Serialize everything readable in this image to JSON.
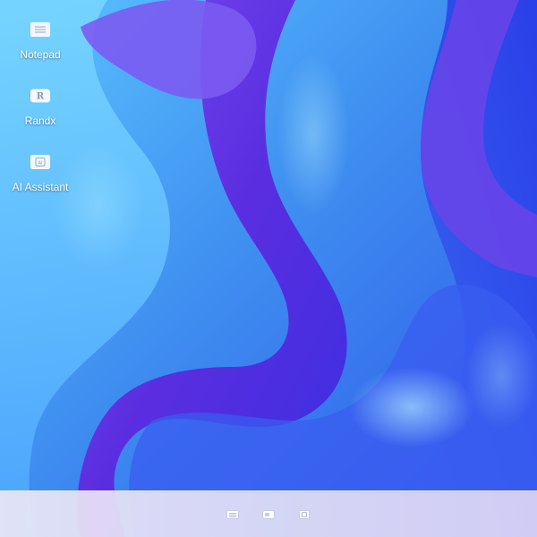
{
  "desktop": {
    "icons": [
      {
        "label": "Notepad",
        "icon": "notepad-icon"
      },
      {
        "label": "Randx",
        "icon": "randx-icon",
        "glyph": "R"
      },
      {
        "label": "AI Assistant",
        "icon": "ai-assistant-icon",
        "glyph": "AI"
      }
    ]
  },
  "taskbar": {
    "apps": [
      {
        "icon": "notepad-icon"
      },
      {
        "icon": "randx-icon"
      },
      {
        "icon": "ai-assistant-icon"
      }
    ]
  },
  "colors": {
    "wallpaper_base": "#3f8ff0",
    "wallpaper_violet": "#5a2ee0",
    "wallpaper_cyan": "#5fd2ff",
    "wallpaper_deep": "#2a3fe8",
    "taskbar": "#e6e2f4",
    "icon_label": "#ffffff"
  }
}
